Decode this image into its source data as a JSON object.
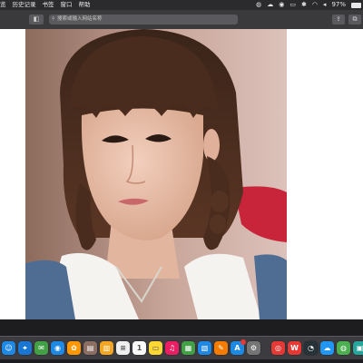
{
  "menubar": {
    "items": [
      "历史记录",
      "书签",
      "窗口",
      "帮助"
    ],
    "leading_fragment": "览",
    "battery_text": "97%",
    "battery_level": 0.97
  },
  "toolbar": {
    "address_text": "搜索或输入网站名称",
    "back_icon": "sidebar-toggle-icon",
    "right_icons": [
      "share-icon",
      "new-tab-icon"
    ]
  },
  "dock": {
    "apps": [
      {
        "name": "finder",
        "color": "#1e88e5",
        "glyph": "☺"
      },
      {
        "name": "safari",
        "color": "#1976d2",
        "glyph": "⌖"
      },
      {
        "name": "messages",
        "color": "#43a047",
        "glyph": "✉"
      },
      {
        "name": "qq",
        "color": "#1e88e5",
        "glyph": "◉"
      },
      {
        "name": "photos",
        "color": "#ff9800",
        "glyph": "✿"
      },
      {
        "name": "notes",
        "color": "#8d6e63",
        "glyph": "▤"
      },
      {
        "name": "notebook",
        "color": "#f5a623",
        "glyph": "▥"
      },
      {
        "name": "reminders",
        "color": "#eeeeee",
        "glyph": "≡"
      },
      {
        "name": "calendar",
        "color": "#fafafa",
        "glyph": "1"
      },
      {
        "name": "stickies",
        "color": "#fdd835",
        "glyph": "▭"
      },
      {
        "name": "music",
        "color": "#e91e63",
        "glyph": "♫"
      },
      {
        "name": "numbers",
        "color": "#43a047",
        "glyph": "▦"
      },
      {
        "name": "keynote",
        "color": "#1e88e5",
        "glyph": "▧"
      },
      {
        "name": "pages",
        "color": "#f57c00",
        "glyph": "✎"
      },
      {
        "name": "app-store",
        "color": "#1e88e5",
        "glyph": "A",
        "badge": true
      },
      {
        "name": "system-preferences",
        "color": "#757575",
        "glyph": "⚙"
      },
      {
        "name": "chrome",
        "color": "#e53935",
        "glyph": "◎"
      },
      {
        "name": "wps",
        "color": "#e53935",
        "glyph": "W"
      },
      {
        "name": "quicktime",
        "color": "#263238",
        "glyph": "◔"
      },
      {
        "name": "baidu-netdisk",
        "color": "#2196f3",
        "glyph": "☁"
      },
      {
        "name": "wechat",
        "color": "#4caf50",
        "glyph": "◍"
      },
      {
        "name": "more",
        "color": "#26a69a",
        "glyph": "▣"
      }
    ]
  }
}
